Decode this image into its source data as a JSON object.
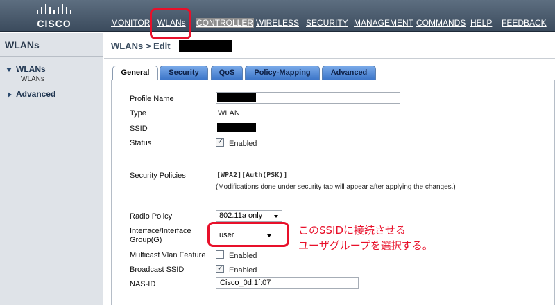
{
  "header": {
    "logo_text": "CISCO",
    "nav": [
      {
        "label": "MONITOR"
      },
      {
        "label": "WLANs"
      },
      {
        "label": "CONTROLLER"
      },
      {
        "label": "WIRELESS"
      },
      {
        "label": "SECURITY"
      },
      {
        "label": "MANAGEMENT"
      },
      {
        "label": "COMMANDS"
      },
      {
        "label": "HELP"
      },
      {
        "label": "FEEDBACK"
      }
    ]
  },
  "sidebar": {
    "title": "WLANs",
    "items": [
      {
        "label": "WLANs",
        "expanded": true,
        "sub": "WLANs"
      },
      {
        "label": "Advanced",
        "expanded": false
      }
    ]
  },
  "main": {
    "title": "WLANs > Edit",
    "tabs": [
      "General",
      "Security",
      "QoS",
      "Policy-Mapping",
      "Advanced"
    ],
    "active_tab": "General",
    "form": {
      "profile_name_label": "Profile Name",
      "type_label": "Type",
      "type_value": "WLAN",
      "ssid_label": "SSID",
      "status_label": "Status",
      "status_checked": true,
      "status_text": "Enabled",
      "security_policies_label": "Security Policies",
      "security_policies_value": "[WPA2][Auth(PSK)]",
      "security_note": "(Modifications done under security tab will appear after applying the changes.)",
      "radio_policy_label": "Radio Policy",
      "radio_policy_value": "802.11a only",
      "interface_label_1": "Interface/Interface",
      "interface_label_2": "Group(G)",
      "interface_value": "user",
      "multicast_label": "Multicast Vlan Feature",
      "multicast_checked": false,
      "multicast_text": "Enabled",
      "broadcast_label": "Broadcast SSID",
      "broadcast_checked": true,
      "broadcast_text": "Enabled",
      "nas_id_label": "NAS-ID",
      "nas_id_value": "Cisco_0d:1f:07"
    }
  },
  "annotation": {
    "line1": "このSSIDに接続させる",
    "line2": "ユーザグループを選択する。"
  },
  "colors": {
    "highlight": "#e8102a",
    "tab_blue": "#3d76c9",
    "header_bg": "#4a5b6d"
  }
}
